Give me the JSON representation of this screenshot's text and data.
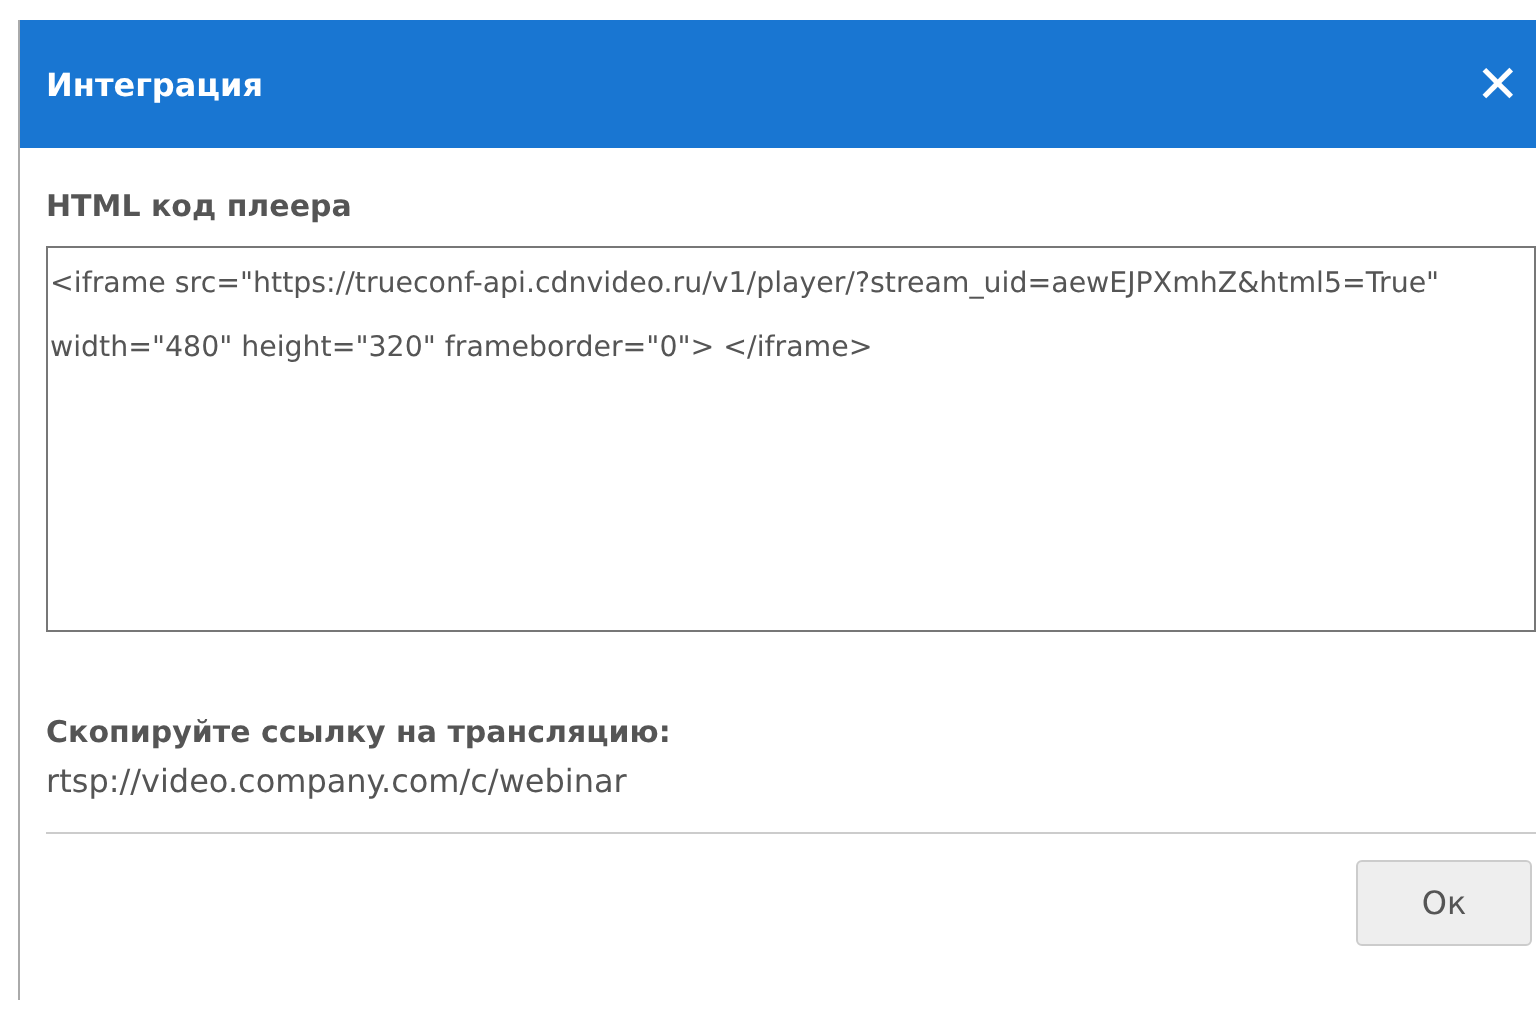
{
  "dialog": {
    "title": "Интеграция",
    "close": "✕",
    "embed": {
      "label": "HTML код плеера",
      "value": "<iframe src=\"https://trueconf-api.cdnvideo.ru/v1/player/?stream_uid=aewEJPXmhZ&html5=True\" width=\"480\" height=\"320\" frameborder=\"0\"> </iframe>"
    },
    "link": {
      "label": "Скопируйте ссылку на трансляцию:",
      "value": "rtsp://video.company.com/c/webinar"
    },
    "buttons": [
      "Ок"
    ]
  }
}
